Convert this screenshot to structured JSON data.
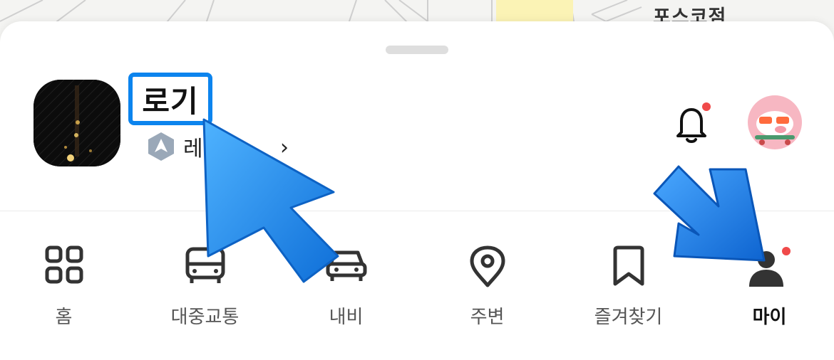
{
  "map": {
    "labels": [
      "",
      "포스코점"
    ]
  },
  "profile": {
    "name": "로기",
    "level_text": "레",
    "chevron": "›"
  },
  "header_icons": {
    "bell": "bell-icon",
    "avatar": "character-avatar-icon",
    "badge_color": "#f04a4a"
  },
  "tabs": [
    {
      "id": "home",
      "label": "홈",
      "icon": "grid-icon",
      "active": false
    },
    {
      "id": "transit",
      "label": "대중교통",
      "icon": "bus-icon",
      "active": false
    },
    {
      "id": "navi",
      "label": "내비",
      "icon": "car-icon",
      "active": false
    },
    {
      "id": "nearby",
      "label": "주변",
      "icon": "location-pin-icon",
      "active": false
    },
    {
      "id": "favorites",
      "label": "즐겨찾기",
      "icon": "bookmark-icon",
      "active": false
    },
    {
      "id": "my",
      "label": "마이",
      "icon": "person-icon",
      "active": true
    }
  ],
  "colors": {
    "highlight_border": "#0c84ee",
    "arrow_blue": "#1f8ef2",
    "active_text": "#111111",
    "inactive_text": "#555555",
    "icon_dark": "#333333"
  }
}
